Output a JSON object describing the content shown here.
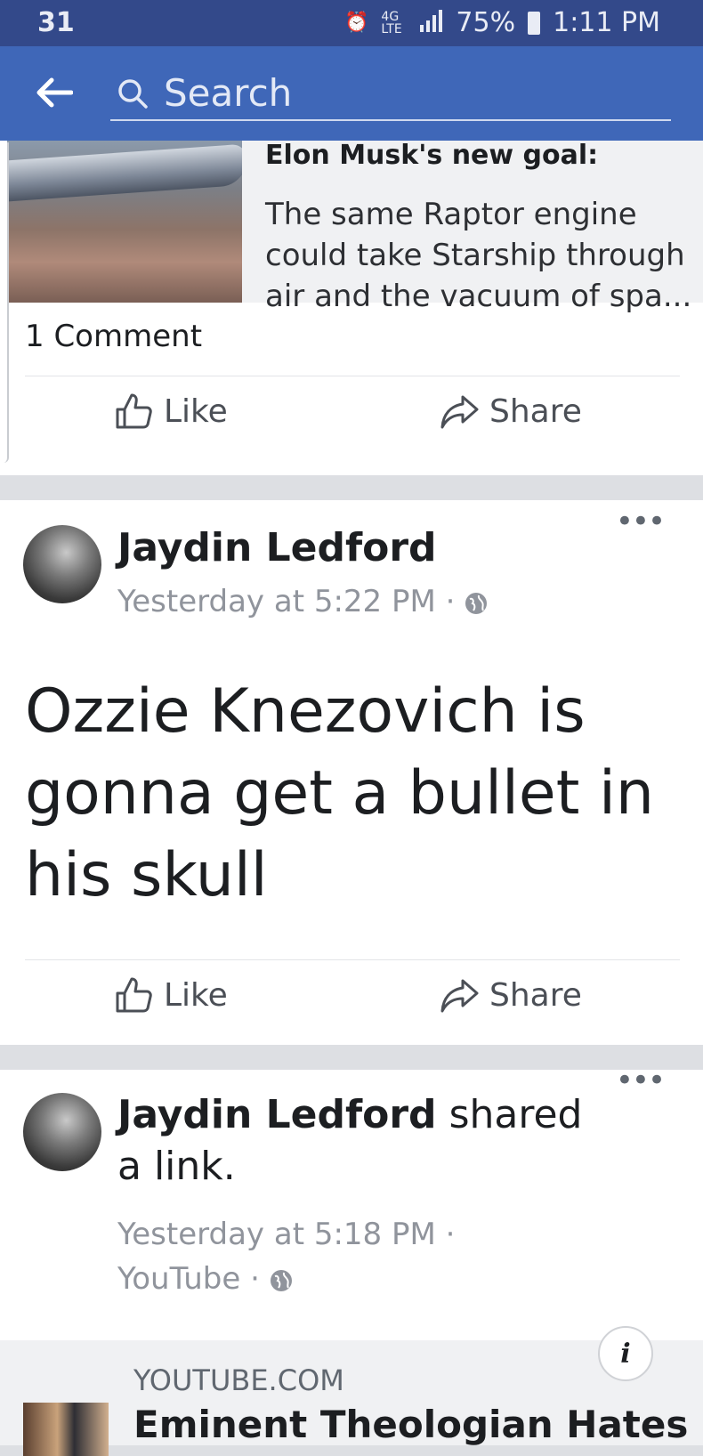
{
  "status_bar": {
    "left": "31",
    "network": "4G LTE",
    "battery": "75%",
    "time": "1:11 PM",
    "icons": [
      "alarm-icon",
      "network-icon",
      "signal-icon",
      "battery-icon"
    ]
  },
  "search": {
    "placeholder": "Search"
  },
  "post1": {
    "link_title": "Elon Musk's new goal:",
    "link_text": "The same Raptor engine could take Starship through air and the vacuum of spa...",
    "comment_count": "1 Comment",
    "like_label": "Like",
    "share_label": "Share"
  },
  "post2": {
    "author": "Jaydin Ledford",
    "meta": "Yesterday at 5:22 PM ·",
    "text": "Ozzie Knezovich is gonna get a bullet in his skull",
    "like_label": "Like",
    "share_label": "Share",
    "more": "•••"
  },
  "post3": {
    "author": "Jaydin Ledford",
    "action": "shared a link.",
    "meta_line1": "Yesterday at 5:18 PM ·",
    "meta_line2": "YouTube ·",
    "more": "•••",
    "link_domain": "YOUTUBE.COM",
    "link_title": "Eminent Theologian Hates",
    "info": "i"
  },
  "colors": {
    "status_bar": "#33498a",
    "search_bar": "#3f67b8",
    "card": "#ffffff",
    "separator": "#dddfe3",
    "meta_text": "#90949c"
  }
}
